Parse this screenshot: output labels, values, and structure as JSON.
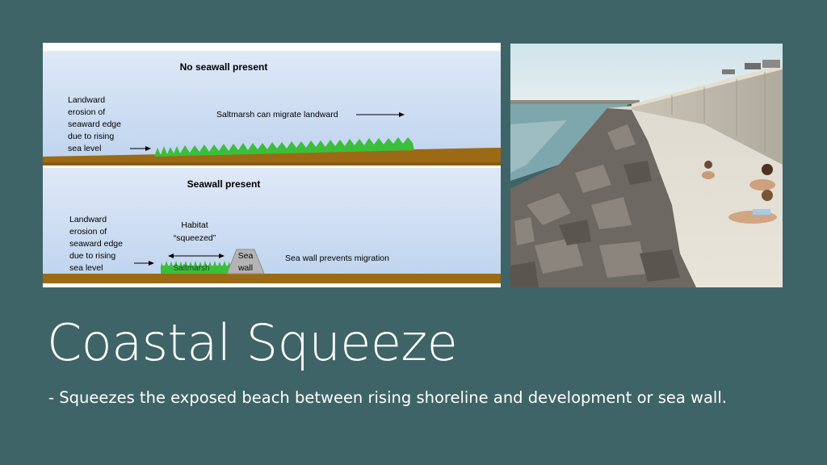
{
  "diagram": {
    "top_panel": {
      "heading": "No seawall present",
      "erosion_lines": [
        "Landward",
        "erosion of",
        "seaward edge",
        "due to rising",
        "sea level"
      ],
      "migrate_label": "Saltmarsh can migrate landward"
    },
    "bottom_panel": {
      "heading": "Seawall present",
      "erosion_lines": [
        "Landward",
        "erosion of",
        "seaward edge",
        "due to rising",
        "sea level"
      ],
      "habitat_lines": [
        "Habitat",
        "“squeezed”"
      ],
      "saltmarsh_label": "Saltmarsh",
      "wall_lines": [
        "Sea",
        "wall"
      ],
      "prevents_label": "Sea wall prevents migration"
    },
    "colors": {
      "sky": "#c9daf1",
      "ground": "#9c6a14",
      "grass": "#3bbf3b",
      "wall": "#b4b4b4"
    }
  },
  "photo": {
    "description_icon": "beach-seawall-photo"
  },
  "slide": {
    "title": "Coastal Squeeze",
    "subtitle": "- Squeezes the exposed beach between rising shoreline and development or sea wall."
  }
}
